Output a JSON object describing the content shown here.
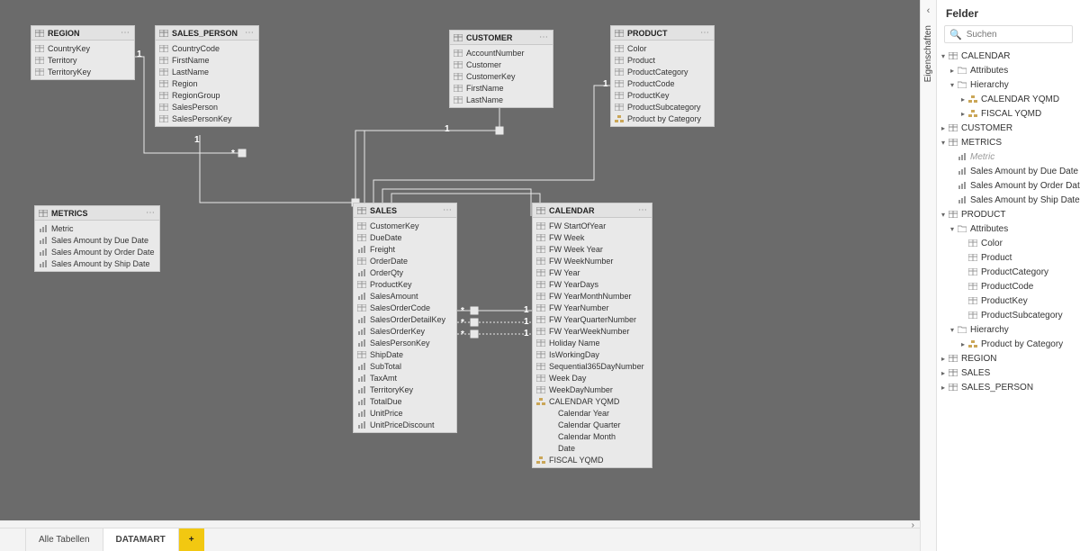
{
  "colors": {
    "accent": "#f2c811"
  },
  "rail": {
    "collapsed_label": "Eigenschaften"
  },
  "fields_panel": {
    "title": "Felder",
    "search_placeholder": "Suchen"
  },
  "tabs": {
    "all": "Alle Tabellen",
    "active": "DATAMART",
    "add": "+"
  },
  "entities": {
    "region": {
      "title": "REGION",
      "fields": [
        "CountryKey",
        "Territory",
        "TerritoryKey"
      ]
    },
    "sales_person": {
      "title": "SALES_PERSON",
      "fields": [
        "CountryCode",
        "FirstName",
        "LastName",
        "Region",
        "RegionGroup",
        "SalesPerson",
        "SalesPersonKey"
      ]
    },
    "customer": {
      "title": "CUSTOMER",
      "fields": [
        "AccountNumber",
        "Customer",
        "CustomerKey",
        "FirstName",
        "LastName"
      ]
    },
    "product": {
      "title": "PRODUCT",
      "fields": [
        "Color",
        "Product",
        "ProductCategory",
        "ProductCode",
        "ProductKey",
        "ProductSubcategory",
        "Product by Category"
      ]
    },
    "metrics": {
      "title": "METRICS",
      "fields": [
        "Metric",
        "Sales Amount by Due Date",
        "Sales Amount by Order Date",
        "Sales Amount by Ship Date"
      ]
    },
    "sales": {
      "title": "SALES",
      "fields": [
        "CustomerKey",
        "DueDate",
        "Freight",
        "OrderDate",
        "OrderQty",
        "ProductKey",
        "SalesAmount",
        "SalesOrderCode",
        "SalesOrderDetailKey",
        "SalesOrderKey",
        "SalesPersonKey",
        "ShipDate",
        "SubTotal",
        "TaxAmt",
        "TerritoryKey",
        "TotalDue",
        "UnitPrice",
        "UnitPriceDiscount"
      ]
    },
    "calendar": {
      "title": "CALENDAR",
      "fields": [
        "FW StartOfYear",
        "FW Week",
        "FW Week Year",
        "FW WeekNumber",
        "FW Year",
        "FW YearDays",
        "FW YearMonthNumber",
        "FW YearNumber",
        "FW YearQuarterNumber",
        "FW YearWeekNumber",
        "Holiday Name",
        "IsWorkingDay",
        "Sequential365DayNumber",
        "Week Day",
        "WeekDayNumber"
      ],
      "hier1": "CALENDAR YQMD",
      "hier1_children": [
        "Calendar Year",
        "Calendar Quarter",
        "Calendar Month",
        "Date"
      ],
      "hier2": "FISCAL YQMD"
    }
  },
  "tree": [
    {
      "d": 0,
      "tw": "▾",
      "icon": "table",
      "label": "CALENDAR"
    },
    {
      "d": 1,
      "tw": "▸",
      "icon": "folder",
      "label": "Attributes"
    },
    {
      "d": 1,
      "tw": "▾",
      "icon": "folder",
      "label": "Hierarchy"
    },
    {
      "d": 2,
      "tw": "▸",
      "icon": "hier",
      "label": "CALENDAR YQMD"
    },
    {
      "d": 2,
      "tw": "▸",
      "icon": "hier",
      "label": "FISCAL YQMD"
    },
    {
      "d": 0,
      "tw": "▸",
      "icon": "table",
      "label": "CUSTOMER"
    },
    {
      "d": 0,
      "tw": "▾",
      "icon": "table",
      "label": "METRICS"
    },
    {
      "d": 1,
      "tw": "",
      "icon": "measure",
      "label": "Metric",
      "muted": true
    },
    {
      "d": 1,
      "tw": "",
      "icon": "measure",
      "label": "Sales Amount by Due Date"
    },
    {
      "d": 1,
      "tw": "",
      "icon": "measure",
      "label": "Sales Amount by Order Date"
    },
    {
      "d": 1,
      "tw": "",
      "icon": "measure",
      "label": "Sales Amount by Ship Date"
    },
    {
      "d": 0,
      "tw": "▾",
      "icon": "table",
      "label": "PRODUCT"
    },
    {
      "d": 1,
      "tw": "▾",
      "icon": "folder",
      "label": "Attributes"
    },
    {
      "d": 2,
      "tw": "",
      "icon": "col",
      "label": "Color"
    },
    {
      "d": 2,
      "tw": "",
      "icon": "col",
      "label": "Product"
    },
    {
      "d": 2,
      "tw": "",
      "icon": "col",
      "label": "ProductCategory"
    },
    {
      "d": 2,
      "tw": "",
      "icon": "col",
      "label": "ProductCode"
    },
    {
      "d": 2,
      "tw": "",
      "icon": "col",
      "label": "ProductKey"
    },
    {
      "d": 2,
      "tw": "",
      "icon": "col",
      "label": "ProductSubcategory"
    },
    {
      "d": 1,
      "tw": "▾",
      "icon": "folder",
      "label": "Hierarchy"
    },
    {
      "d": 2,
      "tw": "▸",
      "icon": "hier",
      "label": "Product by Category"
    },
    {
      "d": 0,
      "tw": "▸",
      "icon": "table",
      "label": "REGION"
    },
    {
      "d": 0,
      "tw": "▸",
      "icon": "table",
      "label": "SALES"
    },
    {
      "d": 0,
      "tw": "▸",
      "icon": "table",
      "label": "SALES_PERSON"
    }
  ]
}
